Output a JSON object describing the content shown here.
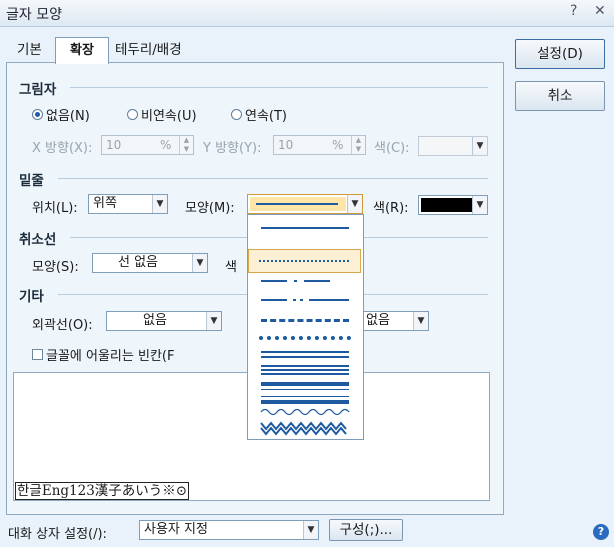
{
  "window": {
    "title": "글자 모양",
    "help": "?",
    "close": "✕"
  },
  "tabs": [
    "기본",
    "확장",
    "테두리/배경"
  ],
  "buttons": {
    "ok": "설정(D)",
    "cancel": "취소"
  },
  "shadow": {
    "title": "그림자",
    "options": [
      "없음(N)",
      "비연속(U)",
      "연속(T)"
    ],
    "selected": "없음(N)",
    "x_label": "X 방향(X):",
    "x_value": "10",
    "x_unit": "%",
    "y_label": "Y 방향(Y):",
    "y_value": "10",
    "y_unit": "%",
    "color_label": "색(C):"
  },
  "underline": {
    "title": "밑줄",
    "pos_label": "위치(L):",
    "pos_value": "위쪽",
    "shape_label": "모양(M):",
    "color_label": "색(R):",
    "color_value": "#000000"
  },
  "strike": {
    "title": "취소선",
    "shape_label": "모양(S):",
    "shape_value": "선 없음",
    "color_label": "색"
  },
  "etc": {
    "title": "기타",
    "outline_label": "외곽선(O):",
    "outline_value": "없음",
    "second_value": "없음",
    "fit_label": "글꼴에 어울리는 빈칸(F"
  },
  "preview": {
    "text": "한글Eng123漢子あいう※⊙"
  },
  "footer": {
    "setting_label": "대화 상자 설정(/):",
    "setting_value": "사용자 지정",
    "config_button": "구성(;)...",
    "help": "?"
  },
  "line_styles": [
    "solid",
    "long-dash",
    "dotted",
    "dash-dot",
    "dash-dot-dot",
    "long-dash-2",
    "round-dot",
    "double",
    "triple-thin",
    "thick-thin",
    "thin-thick",
    "wave",
    "double-wave"
  ],
  "selected_line_style": "dotted"
}
